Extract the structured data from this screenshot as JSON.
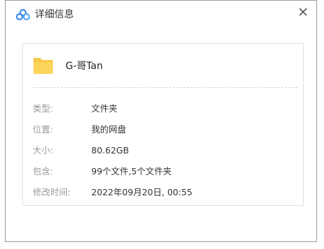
{
  "dialog": {
    "title": "详细信息",
    "logo_icon": "baidu-netdisk-cloud-icon",
    "close_icon": "close-icon"
  },
  "file": {
    "icon": "folder-icon",
    "name": "G-哥Tan"
  },
  "details": [
    {
      "label": "类型:",
      "value": "文件夹"
    },
    {
      "label": "位置:",
      "value": "我的网盘"
    },
    {
      "label": "大小:",
      "value": "80.62GB"
    },
    {
      "label": "包含:",
      "value": "99个文件,5个文件夹"
    },
    {
      "label": "修改时间:",
      "value": "2022年09月20日, 00:55"
    }
  ],
  "colors": {
    "folder": "#f7c948",
    "logo_blue": "#3b8cf0",
    "label": "#9a9a9a",
    "value": "#333333"
  }
}
